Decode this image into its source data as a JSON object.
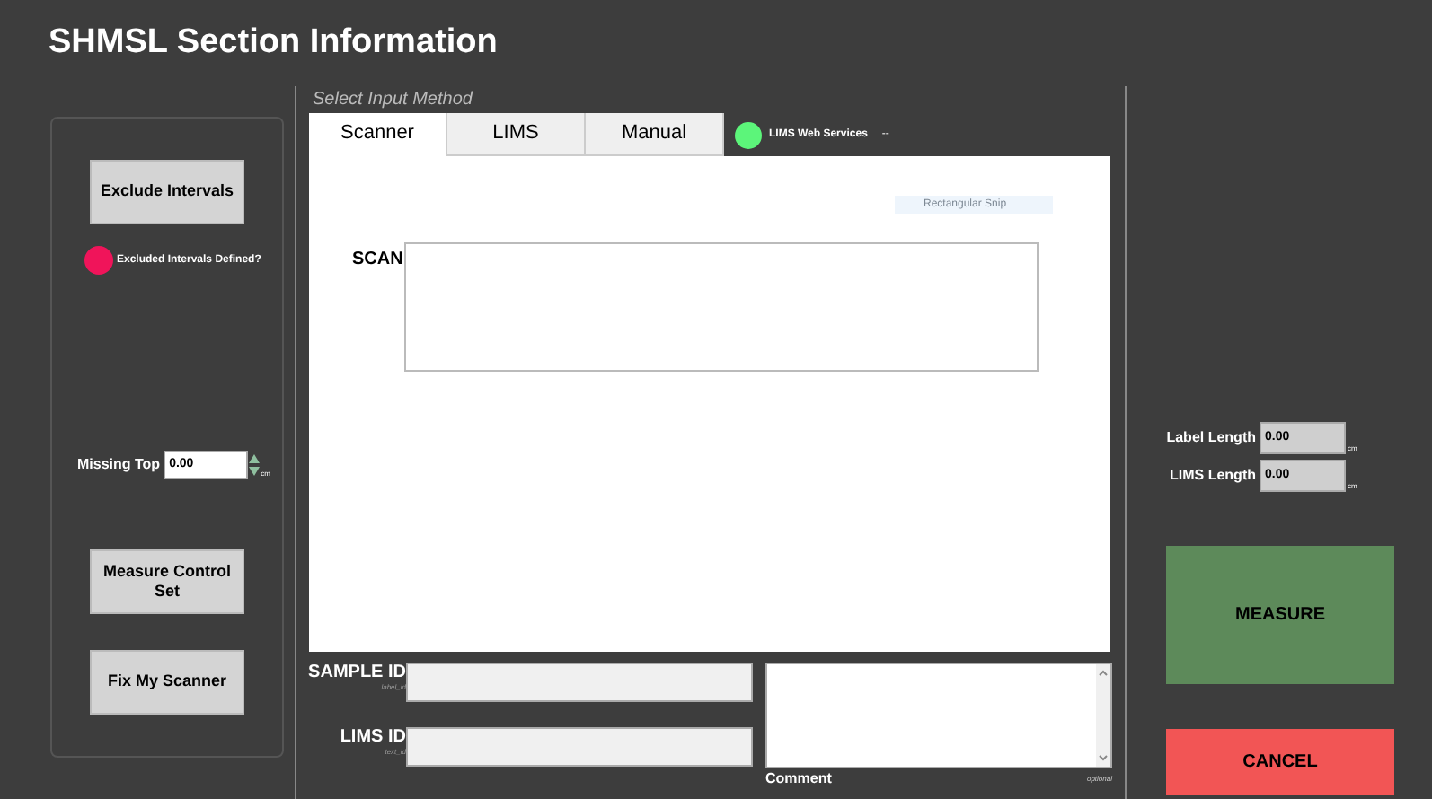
{
  "title": "SHMSL Section Information",
  "left_panel": {
    "exclude_button": "Exclude Intervals",
    "excluded_indicator": {
      "label": "Excluded Intervals Defined?",
      "color": "#f0145a"
    },
    "missing_top": {
      "label": "Missing Top",
      "value": "0.00",
      "unit": "cm"
    },
    "buttons": [
      "Measure Control Set",
      "Fix My Scanner"
    ]
  },
  "input_method": {
    "label": "Select Input Method",
    "tabs": [
      {
        "label": "Scanner",
        "selected": true
      },
      {
        "label": "LIMS",
        "selected": false
      },
      {
        "label": "Manual",
        "selected": false
      }
    ],
    "web_services": {
      "label": "LIMS Web Services",
      "color": "#5cf57a",
      "status": "--"
    },
    "snip_hint": "Rectangular Snip",
    "scan_label": "SCAN"
  },
  "sample_id": {
    "label": "SAMPLE ID",
    "sublabel": "label_id"
  },
  "lims_id": {
    "label": "LIMS ID",
    "sublabel": "text_id"
  },
  "comment": {
    "label": "Comment",
    "hint": "optional"
  },
  "lengths": [
    {
      "label": "Label Length",
      "value": "0.00",
      "unit": "cm"
    },
    {
      "label": "LIMS Length",
      "value": "0.00",
      "unit": "cm"
    }
  ],
  "measure_button": "MEASURE",
  "cancel_button": "CANCEL"
}
